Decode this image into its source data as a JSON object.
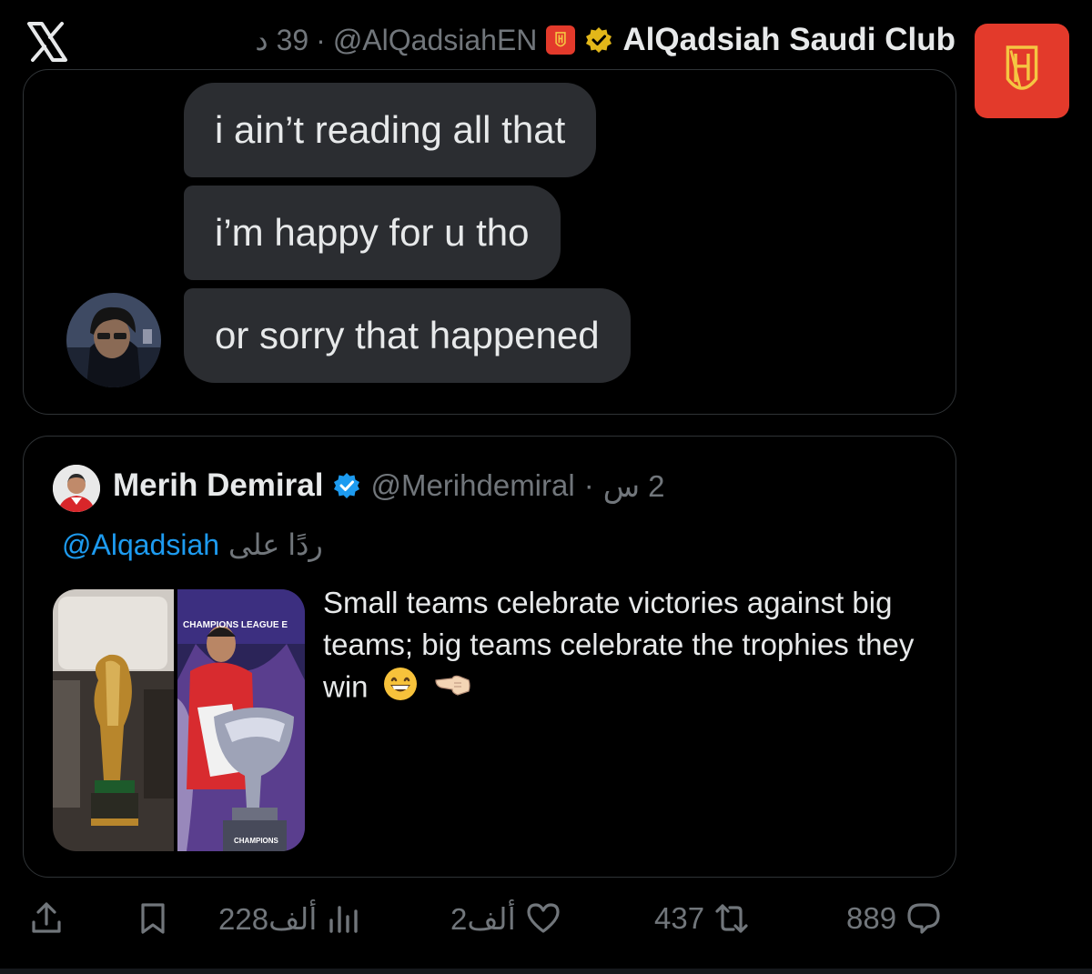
{
  "header": {
    "time_ago": "39 د",
    "handle": "@AlQadsiahEN",
    "separator": "·",
    "display_name": "AlQadsiah Saudi Club"
  },
  "chat_bubbles": [
    {
      "text": "i ain’t reading all that"
    },
    {
      "text": "i’m happy for u tho"
    },
    {
      "text": "or sorry that happened"
    }
  ],
  "quoted_tweet": {
    "name": "Merih Demiral",
    "handle": "@Merihdemiral",
    "separator": "·",
    "time_ago": "2 س",
    "reply_label": "ردًا على",
    "reply_handle": "@Alqadsiah",
    "text": "Small teams celebrate victories against big teams; big teams celebrate the trophies they win",
    "media_banner_text": "CHAMPIONS LEAGUE E",
    "media_podium_text": "CHAMPIONS"
  },
  "actions": {
    "replies": "889",
    "retweets": "437",
    "likes": "2ألف",
    "views": "228ألف"
  },
  "colors": {
    "background": "#000000",
    "brand_red": "#e33a2b",
    "link_blue": "#1d9bf0",
    "muted": "#71767b",
    "bubble": "#2b2d31"
  }
}
